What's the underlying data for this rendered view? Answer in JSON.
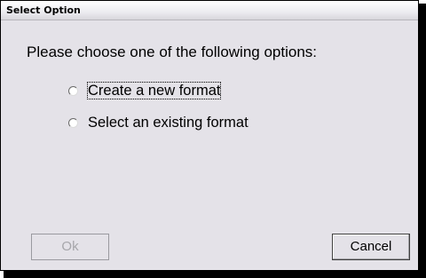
{
  "dialog": {
    "title": "Select Option",
    "prompt": "Please choose one of the following options:"
  },
  "options": [
    {
      "label": "Create a new format",
      "selected": false,
      "focused": true
    },
    {
      "label": "Select an existing format",
      "selected": false,
      "focused": false
    }
  ],
  "buttons": {
    "ok_label": "Ok",
    "ok_enabled": false,
    "cancel_label": "Cancel"
  },
  "colors": {
    "dialog_background": "#e4e2e8",
    "disabled_text": "#a6a6aa"
  }
}
